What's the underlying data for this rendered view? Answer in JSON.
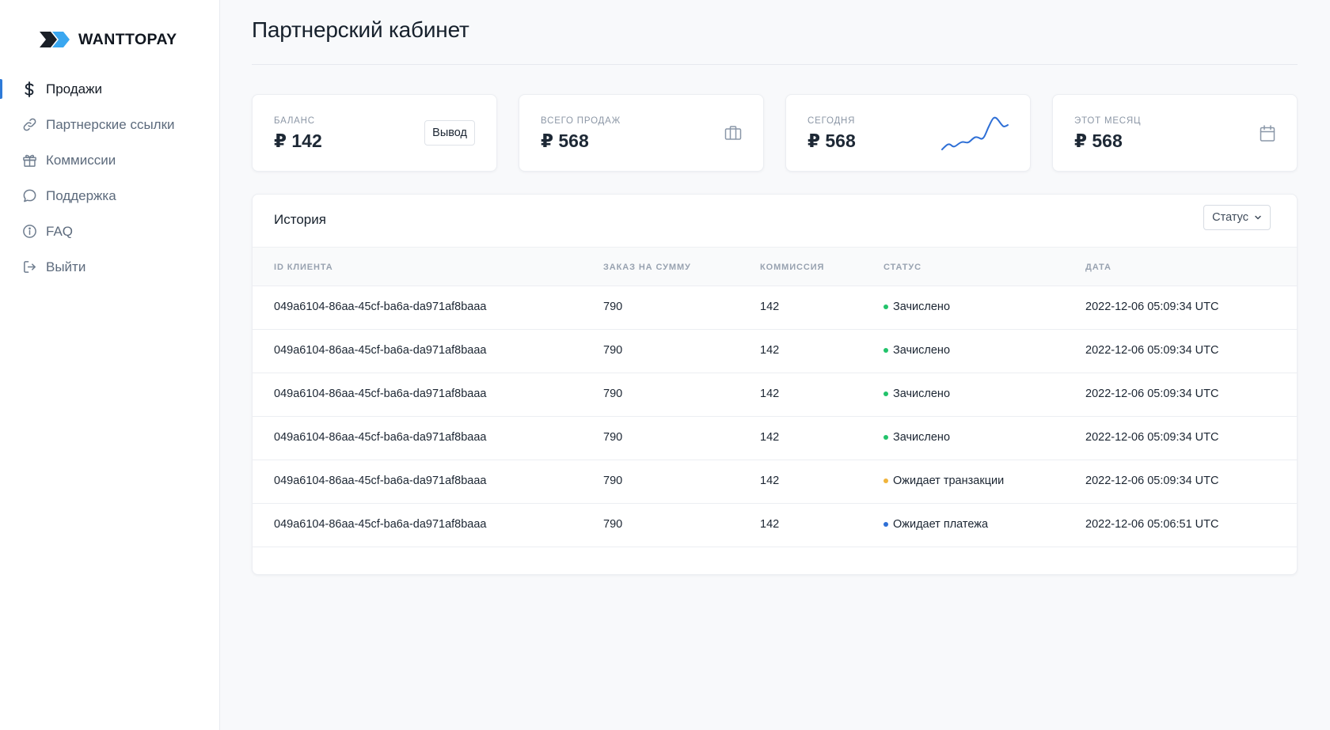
{
  "brand": {
    "name": "WANTTOPAY"
  },
  "sidebar": {
    "items": [
      {
        "label": "Продажи",
        "icon": "dollar-icon",
        "active": true
      },
      {
        "label": "Партнерские ссылки",
        "icon": "link-icon",
        "active": false
      },
      {
        "label": "Коммиссии",
        "icon": "gift-icon",
        "active": false
      },
      {
        "label": "Поддержка",
        "icon": "chat-bubble-icon",
        "active": false
      },
      {
        "label": "FAQ",
        "icon": "info-circle-icon",
        "active": false
      },
      {
        "label": "Выйти",
        "icon": "logout-icon",
        "active": false
      }
    ]
  },
  "page": {
    "title": "Партнерский кабинет"
  },
  "cards": {
    "balance": {
      "label": "Баланс",
      "value": "₽ 142",
      "button": "Вывод"
    },
    "total": {
      "label": "Всего продаж",
      "value": "₽ 568",
      "icon": "briefcase-icon"
    },
    "today": {
      "label": "Сегодня",
      "value": "₽ 568",
      "icon": "sparkline-chart-icon"
    },
    "month": {
      "label": "Этот месяц",
      "value": "₽ 568",
      "icon": "calendar-icon"
    }
  },
  "history": {
    "title": "История",
    "filter_label": "Статус",
    "columns": {
      "client_id": "ID клиента",
      "order_sum": "Заказ на сумму",
      "commission": "Коммиссия",
      "status": "Статус",
      "date": "Дата"
    },
    "rows": [
      {
        "client_id": "049a6104-86aa-45cf-ba6a-da971af8baaa",
        "order_sum": "790",
        "commission": "142",
        "status": "Зачислено",
        "status_color": "#22c36b",
        "date": "2022-12-06 05:09:34 UTC"
      },
      {
        "client_id": "049a6104-86aa-45cf-ba6a-da971af8baaa",
        "order_sum": "790",
        "commission": "142",
        "status": "Зачислено",
        "status_color": "#22c36b",
        "date": "2022-12-06 05:09:34 UTC"
      },
      {
        "client_id": "049a6104-86aa-45cf-ba6a-da971af8baaa",
        "order_sum": "790",
        "commission": "142",
        "status": "Зачислено",
        "status_color": "#22c36b",
        "date": "2022-12-06 05:09:34 UTC"
      },
      {
        "client_id": "049a6104-86aa-45cf-ba6a-da971af8baaa",
        "order_sum": "790",
        "commission": "142",
        "status": "Зачислено",
        "status_color": "#22c36b",
        "date": "2022-12-06 05:09:34 UTC"
      },
      {
        "client_id": "049a6104-86aa-45cf-ba6a-da971af8baaa",
        "order_sum": "790",
        "commission": "142",
        "status": "Ожидает транзакции",
        "status_color": "#f0b43c",
        "date": "2022-12-06 05:09:34 UTC"
      },
      {
        "client_id": "049a6104-86aa-45cf-ba6a-da971af8baaa",
        "order_sum": "790",
        "commission": "142",
        "status": "Ожидает платежа",
        "status_color": "#2e6fd6",
        "date": "2022-12-06 05:06:51 UTC"
      }
    ]
  },
  "colors": {
    "accent": "#2e7ad8",
    "logo_dark": "#1a1f27",
    "logo_light": "#3aa7f0"
  }
}
